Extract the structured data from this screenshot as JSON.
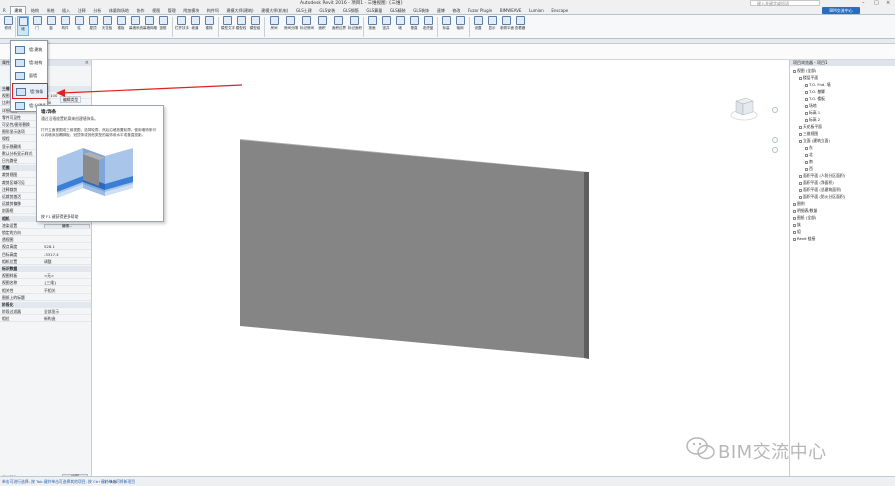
{
  "window": {
    "title": "Autodesk Revit 2016 -   项目1 - 三维视图: {三维}",
    "search_placeholder": "键入关键字或短语",
    "controls": [
      "–",
      "□",
      "×"
    ]
  },
  "tabs": [
    "建筑",
    "结构",
    "系统",
    "插入",
    "注释",
    "分析",
    "体量和场地",
    "协作",
    "视图",
    "管理",
    "附加模块",
    "构件坞",
    "建模大师(建筑)",
    "建模大师(机电)",
    "GLS土建",
    "GLS安装",
    "GLS钢筋",
    "GLS算量",
    "GLS精装",
    "GLS装饰",
    "速博",
    "修改",
    "Fuzor Plugin",
    "BIMWEAVE",
    "Lumion",
    "Enscape"
  ],
  "active_tab": "建筑",
  "badge": "BIM交流中心",
  "ribbon": {
    "buttons": [
      "修改",
      "墙",
      "门",
      "窗",
      "构件",
      "柱",
      "屋顶",
      "天花板",
      "楼板",
      "幕墙系统",
      "幕墙网格",
      "竖梃",
      "栏杆扶手",
      "坡道",
      "楼梯",
      "模型文字",
      "模型线",
      "模型组",
      "房间",
      "房间分隔",
      "标记房间",
      "面积",
      "面积边界",
      "标记面积",
      "按面",
      "竖井",
      "墙",
      "垂直",
      "老虎窗",
      "标高",
      "轴网",
      "设置",
      "显示",
      "参照平面",
      "查看器"
    ],
    "selected": "墙"
  },
  "dropdown": {
    "items": [
      "墙:建筑",
      "墙:结构",
      "面墙",
      "墙:饰条",
      "墙:分隔条"
    ],
    "highlighted": "墙:饰条"
  },
  "tooltip": {
    "title": "墙:饰条",
    "description": "通过沿墙放置轮廓来创建墙饰条。",
    "detail": "打开立面视图或三维视图，选择轮廓，然后沿墙放置轮廓。使用墙饰条可以向墙添加踢脚板、冠顶饰或其他类型的装饰用水平或垂直投影。",
    "help": "按 F1 键获得更多帮助"
  },
  "edit_type_label": "编辑类型",
  "properties": {
    "title": "属性",
    "rows": [
      {
        "k": "三维视图",
        "v": "",
        "group": true
      },
      {
        "k": "视图比例",
        "v": "1 : 100"
      },
      {
        "k": "比例值 1:",
        "v": "100"
      },
      {
        "k": "详细程度",
        "v": "粗略"
      },
      {
        "k": "零件可见性",
        "v": "显示原状态"
      },
      {
        "k": "可见性/图形替换",
        "v": "编辑..."
      },
      {
        "k": "图形显示选项",
        "v": "编辑..."
      },
      {
        "k": "规程",
        "v": "协调"
      },
      {
        "k": "显示隐藏线",
        "v": "按规程"
      },
      {
        "k": "默认分析显示样式",
        "v": "无"
      },
      {
        "k": "日光路径",
        "v": ""
      },
      {
        "k": "范围",
        "v": "",
        "group": true
      },
      {
        "k": "裁剪视图",
        "v": ""
      },
      {
        "k": "裁剪区域可见",
        "v": ""
      },
      {
        "k": "注释裁剪",
        "v": ""
      },
      {
        "k": "远裁剪激活",
        "v": ""
      },
      {
        "k": "远裁剪偏移",
        "v": "304800.0"
      },
      {
        "k": "剖面框",
        "v": ""
      },
      {
        "k": "相机",
        "v": "",
        "group": true
      },
      {
        "k": "渲染设置",
        "v": "编辑..."
      },
      {
        "k": "锁定的方向",
        "v": ""
      },
      {
        "k": "透视图",
        "v": ""
      },
      {
        "k": "视点高度",
        "v": "528.1"
      },
      {
        "k": "目标高度",
        "v": "-3317.4"
      },
      {
        "k": "相机位置",
        "v": "调整"
      },
      {
        "k": "标识数据",
        "v": "",
        "group": true
      },
      {
        "k": "视图样板",
        "v": "<无>"
      },
      {
        "k": "视图名称",
        "v": "{三维}"
      },
      {
        "k": "相关性",
        "v": "不相关"
      },
      {
        "k": "图纸上的标题",
        "v": ""
      },
      {
        "k": "阶段化",
        "v": "",
        "group": true
      },
      {
        "k": "阶段过滤器",
        "v": "全部显示"
      },
      {
        "k": "相位",
        "v": "新构造"
      }
    ],
    "help_link": "属性帮助",
    "apply_label": "应用"
  },
  "project_browser": {
    "title": "项目浏览器 - 项目1",
    "nodes": [
      {
        "label": "视图 (全部)",
        "level": 0
      },
      {
        "label": "楼层平面",
        "level": 1
      },
      {
        "label": "T.O. Fnd. 墙",
        "level": 2
      },
      {
        "label": "T.O. 基脚",
        "level": 2
      },
      {
        "label": "T.O. 楼板",
        "level": 2
      },
      {
        "label": "场地",
        "level": 2
      },
      {
        "label": "标高 1",
        "level": 2
      },
      {
        "label": "标高 2",
        "level": 2
      },
      {
        "label": "天花板平面",
        "level": 1
      },
      {
        "label": "三维视图",
        "level": 1
      },
      {
        "label": "立面 (建筑立面)",
        "level": 1
      },
      {
        "label": "东",
        "level": 2
      },
      {
        "label": "北",
        "level": 2
      },
      {
        "label": "南",
        "level": 2
      },
      {
        "label": "西",
        "level": 2
      },
      {
        "label": "面积平面 (人防分区面积)",
        "level": 1
      },
      {
        "label": "面积平面 (净面积)",
        "level": 1
      },
      {
        "label": "面积平面 (总建筑面积)",
        "level": 1
      },
      {
        "label": "面积平面 (防火分区面积)",
        "level": 1
      },
      {
        "label": "图例",
        "level": 0
      },
      {
        "label": "明细表/数量",
        "level": 0
      },
      {
        "label": "图纸 (全部)",
        "level": 0
      },
      {
        "label": "族",
        "level": 0
      },
      {
        "label": "组",
        "level": 0
      },
      {
        "label": "Revit 链接",
        "level": 0
      }
    ]
  },
  "status": {
    "left": "单击可进行选择; 按 Tab 键并单击可选择其他项目; 按 Ctrl 键并单击可将新项目",
    "scale": "1 : 100"
  },
  "watermark": "BIM交流中心",
  "colors": {
    "wall_face": "#858585",
    "wall_top": "#b3b3b3",
    "wall_side": "#5e5e5e",
    "highlight": "#e02020",
    "accent": "#2a6ebb"
  }
}
